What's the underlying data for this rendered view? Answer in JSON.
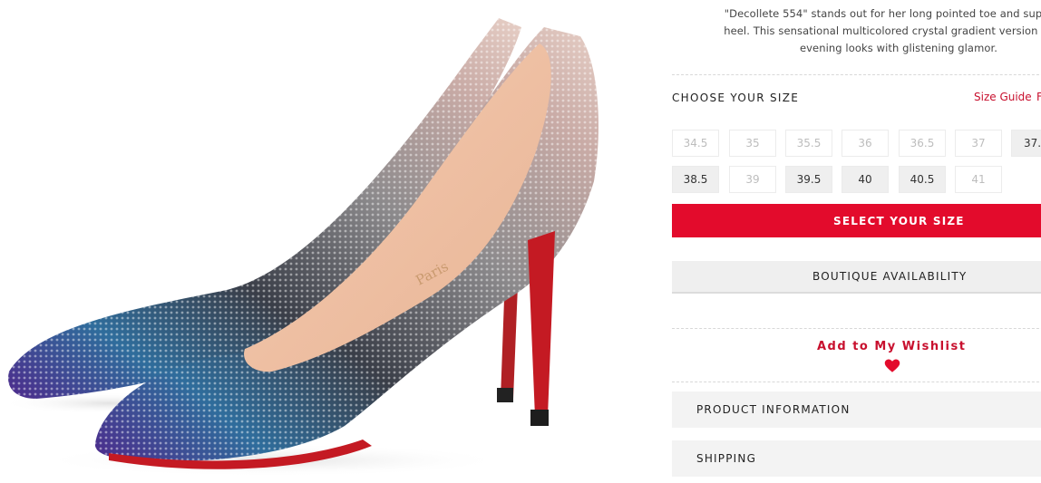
{
  "product": {
    "description_lines": [
      "\"Decollete 554\" stands out for her long pointed toe and superfine",
      "heel. This sensational multicolored crystal gradient version infuse",
      "evening looks with glistening glamor."
    ]
  },
  "size_section": {
    "heading": "CHOOSE YOUR SIZE",
    "size_guide_label": "Size Guide",
    "second_link_partial": "F",
    "sizes_row1": [
      {
        "label": "34.5",
        "available": false
      },
      {
        "label": "35",
        "available": false
      },
      {
        "label": "35.5",
        "available": false
      },
      {
        "label": "36",
        "available": false
      },
      {
        "label": "36.5",
        "available": false
      },
      {
        "label": "37",
        "available": false
      },
      {
        "label": "37.",
        "available": true
      }
    ],
    "sizes_row2": [
      {
        "label": "38.5",
        "available": true
      },
      {
        "label": "39",
        "available": false
      },
      {
        "label": "39.5",
        "available": true
      },
      {
        "label": "40",
        "available": true
      },
      {
        "label": "40.5",
        "available": true
      },
      {
        "label": "41",
        "available": false
      }
    ]
  },
  "actions": {
    "select_size_label": "SELECT YOUR SIZE",
    "boutique_label": "BOUTIQUE AVAILABILITY",
    "wishlist_label": "Add to My Wishlist"
  },
  "accordion": {
    "product_info_label": "PRODUCT INFORMATION",
    "shipping_label": "SHIPPING"
  },
  "image": {
    "sole_text": "Paris"
  },
  "colors": {
    "accent_red": "#e30b2c",
    "link_red": "#c8102e",
    "button_grey": "#efefef"
  },
  "icons": {
    "wishlist": "heart-icon"
  }
}
